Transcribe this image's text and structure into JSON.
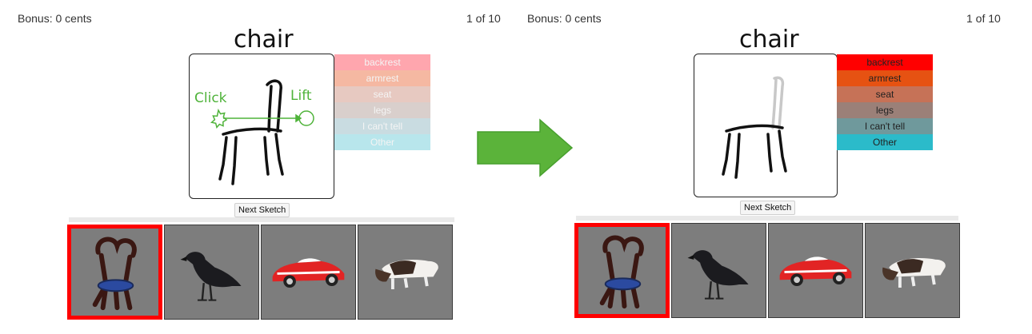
{
  "left": {
    "bonus": "Bonus: 0 cents",
    "progress": "1 of 10",
    "category_title": "chair",
    "next_button": "Next Sketch",
    "annotation_click": "Click",
    "annotation_lift": "Lift",
    "labels": [
      {
        "text": "backrest",
        "color": "#ffa6ae"
      },
      {
        "text": "armrest",
        "color": "#f5b8a2"
      },
      {
        "text": "seat",
        "color": "#e7c9c1"
      },
      {
        "text": "legs",
        "color": "#d9cfcc"
      },
      {
        "text": "I can't tell",
        "color": "#c9dce1"
      },
      {
        "text": "Other",
        "color": "#b8e6ec"
      }
    ]
  },
  "right": {
    "bonus": "Bonus: 0 cents",
    "progress": "1 of 10",
    "category_title": "chair",
    "next_button": "Next Sketch",
    "labels": [
      {
        "text": "backrest",
        "color": "#ff0000"
      },
      {
        "text": "armrest",
        "color": "#e65212"
      },
      {
        "text": "seat",
        "color": "#c67257"
      },
      {
        "text": "legs",
        "color": "#9b8078"
      },
      {
        "text": "I can't tell",
        "color": "#6f999c"
      },
      {
        "text": "Other",
        "color": "#2bbbca"
      }
    ]
  },
  "gallery_items": [
    "chair",
    "crow",
    "car",
    "dog"
  ],
  "colors": {
    "annotation_green": "#4fb33a",
    "arrow_green": "#5bb33a",
    "selected_border": "#ff0000",
    "thumb_bg": "#7d7d7d"
  }
}
